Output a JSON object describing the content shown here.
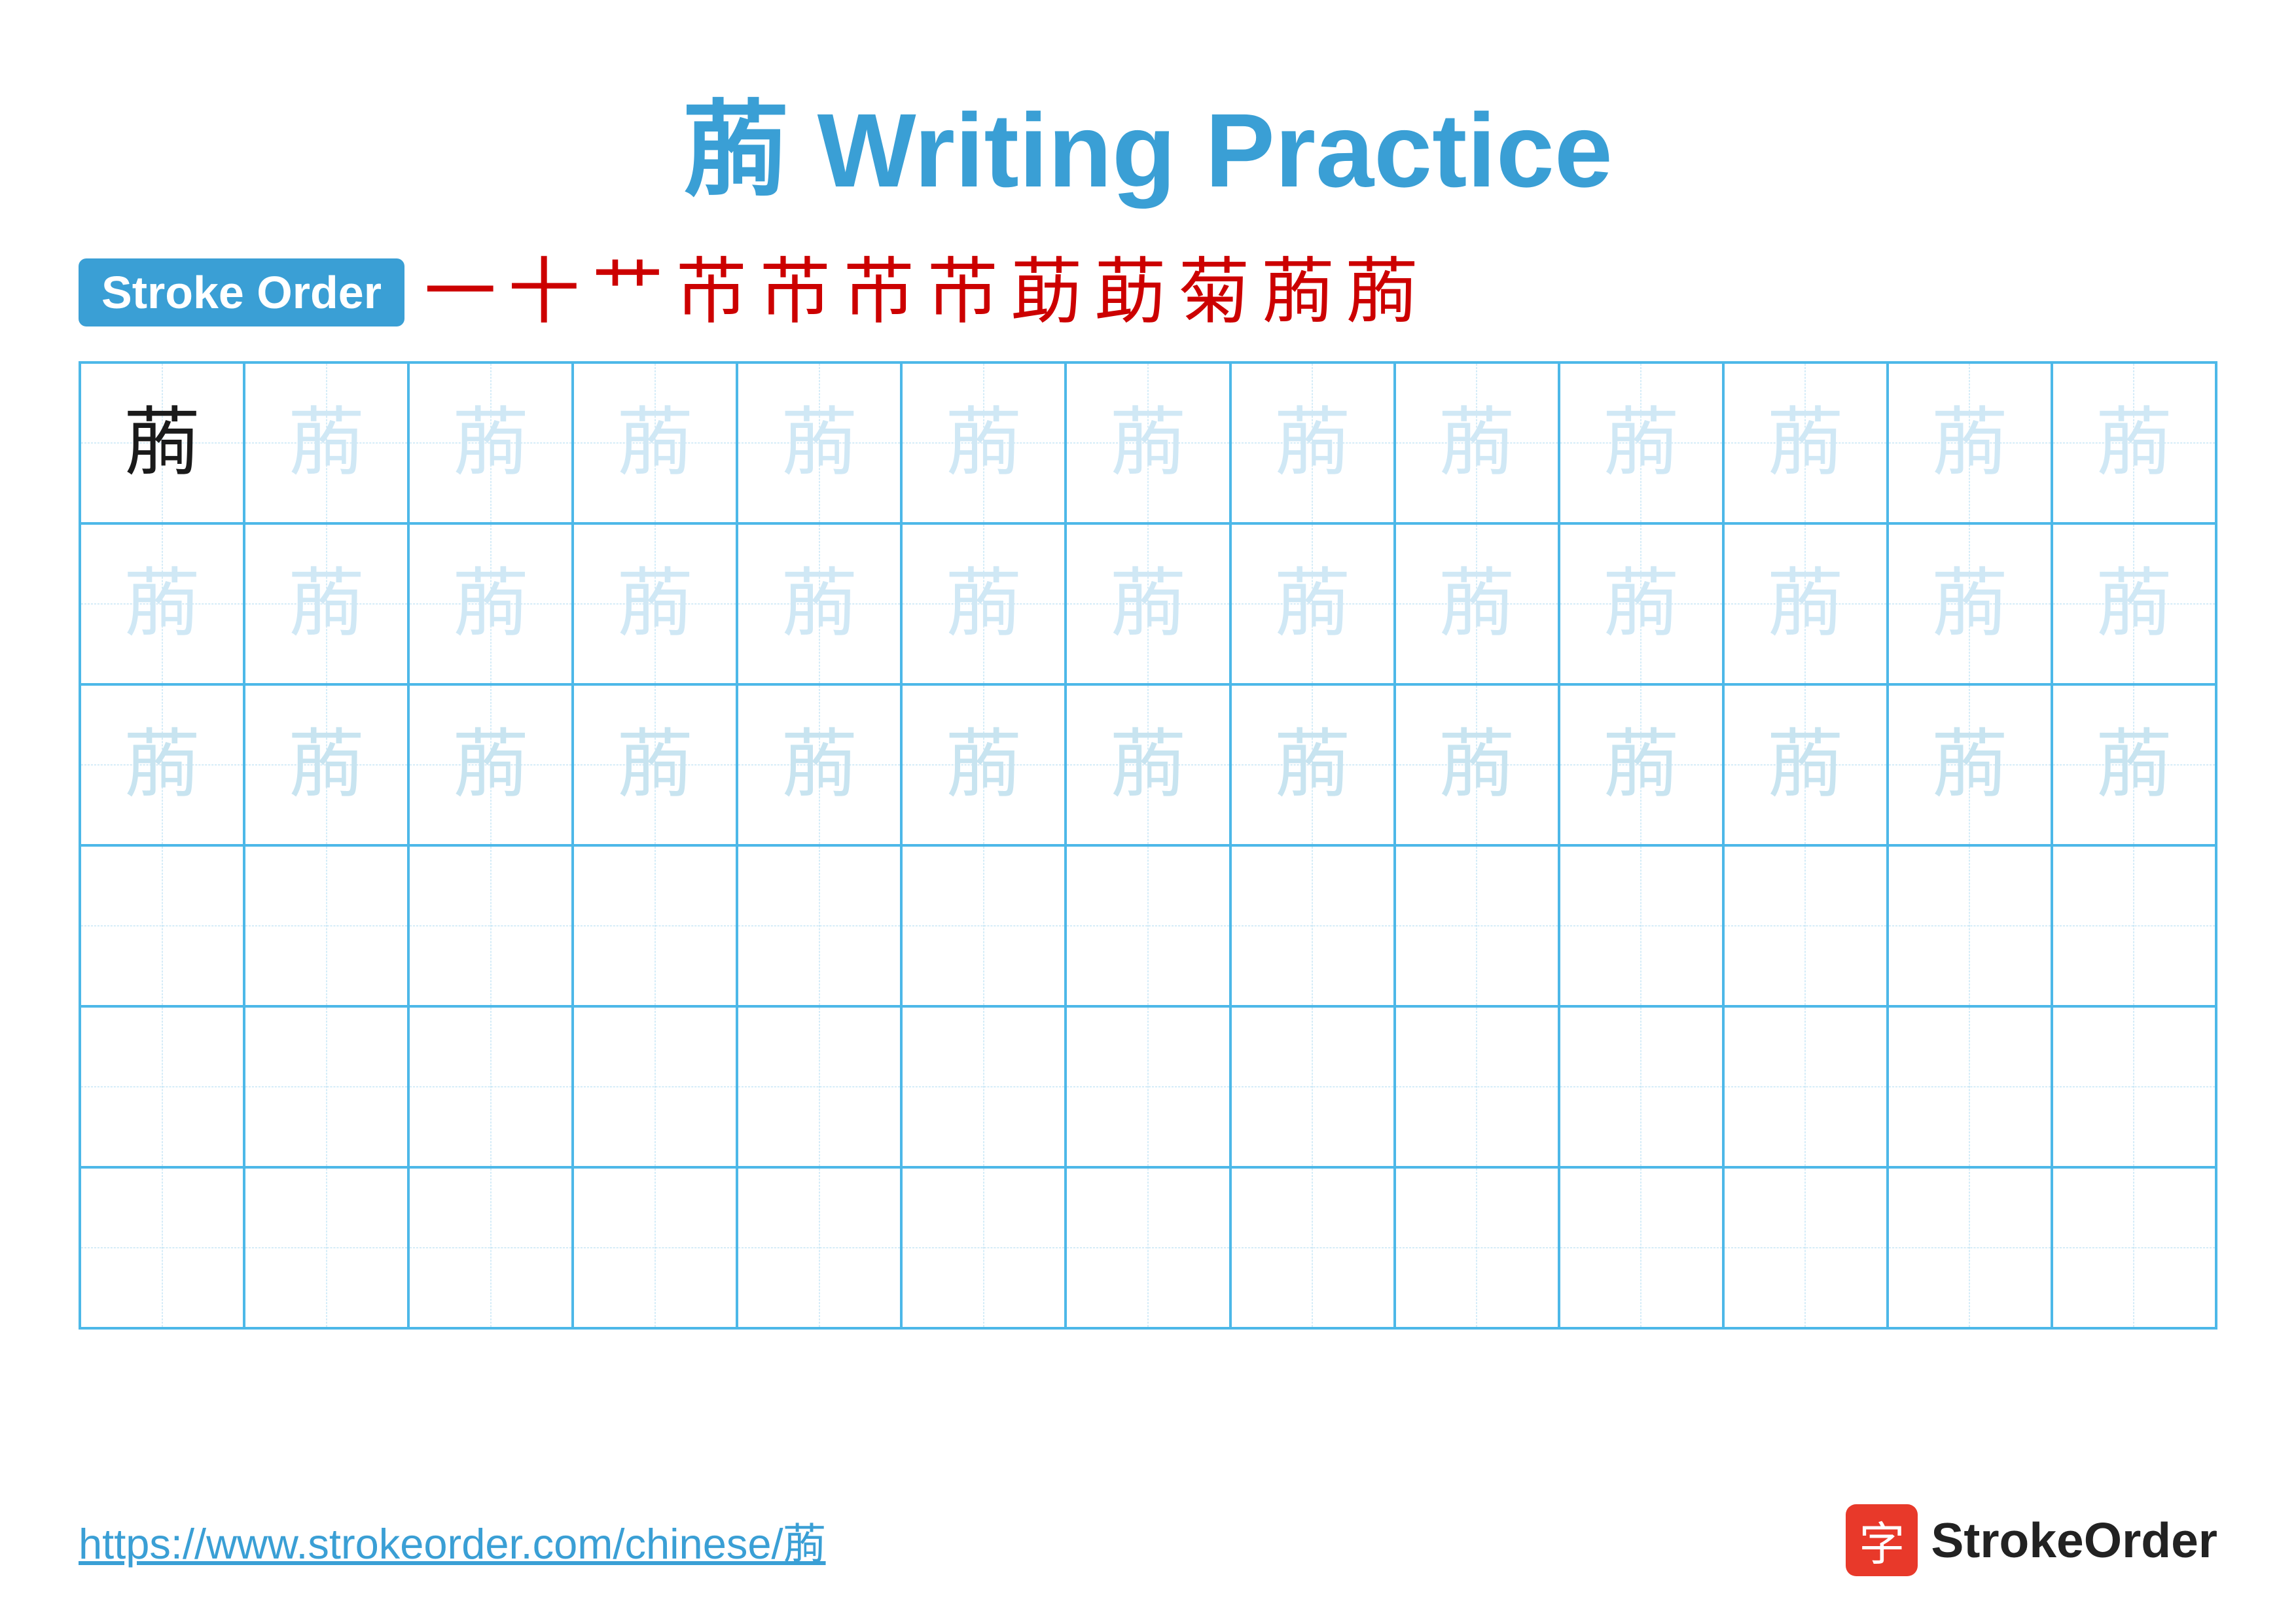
{
  "title": "葋 Writing Practice",
  "title_char": "葋",
  "title_suffix": " Writing Practice",
  "stroke_order_label": "Stroke Order",
  "stroke_sequence": [
    "一",
    "十",
    "艹",
    "芇",
    "芇",
    "芇",
    "芇",
    "莇",
    "莇",
    "菊",
    "葋",
    "葋"
  ],
  "character": "葋",
  "footer_url": "https://www.strokeorder.com/chinese/葋",
  "footer_logo_char": "字",
  "footer_logo_name": "StrokeOrder",
  "grid": {
    "rows": 6,
    "cols": 13
  },
  "row_styles": [
    "mixed",
    "light",
    "lighter",
    "empty",
    "empty",
    "empty"
  ]
}
